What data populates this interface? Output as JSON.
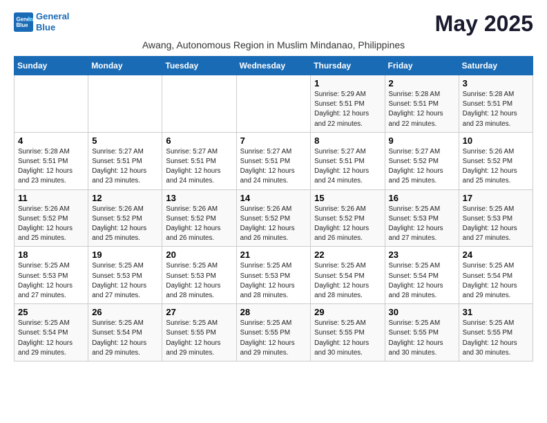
{
  "logo": {
    "line1": "General",
    "line2": "Blue"
  },
  "title": "May 2025",
  "subtitle": "Awang, Autonomous Region in Muslim Mindanao, Philippines",
  "weekdays": [
    "Sunday",
    "Monday",
    "Tuesday",
    "Wednesday",
    "Thursday",
    "Friday",
    "Saturday"
  ],
  "weeks": [
    [
      {
        "day": "",
        "sunrise": "",
        "sunset": "",
        "daylight": ""
      },
      {
        "day": "",
        "sunrise": "",
        "sunset": "",
        "daylight": ""
      },
      {
        "day": "",
        "sunrise": "",
        "sunset": "",
        "daylight": ""
      },
      {
        "day": "",
        "sunrise": "",
        "sunset": "",
        "daylight": ""
      },
      {
        "day": "1",
        "sunrise": "Sunrise: 5:29 AM",
        "sunset": "Sunset: 5:51 PM",
        "daylight": "Daylight: 12 hours and 22 minutes."
      },
      {
        "day": "2",
        "sunrise": "Sunrise: 5:28 AM",
        "sunset": "Sunset: 5:51 PM",
        "daylight": "Daylight: 12 hours and 22 minutes."
      },
      {
        "day": "3",
        "sunrise": "Sunrise: 5:28 AM",
        "sunset": "Sunset: 5:51 PM",
        "daylight": "Daylight: 12 hours and 23 minutes."
      }
    ],
    [
      {
        "day": "4",
        "sunrise": "Sunrise: 5:28 AM",
        "sunset": "Sunset: 5:51 PM",
        "daylight": "Daylight: 12 hours and 23 minutes."
      },
      {
        "day": "5",
        "sunrise": "Sunrise: 5:27 AM",
        "sunset": "Sunset: 5:51 PM",
        "daylight": "Daylight: 12 hours and 23 minutes."
      },
      {
        "day": "6",
        "sunrise": "Sunrise: 5:27 AM",
        "sunset": "Sunset: 5:51 PM",
        "daylight": "Daylight: 12 hours and 24 minutes."
      },
      {
        "day": "7",
        "sunrise": "Sunrise: 5:27 AM",
        "sunset": "Sunset: 5:51 PM",
        "daylight": "Daylight: 12 hours and 24 minutes."
      },
      {
        "day": "8",
        "sunrise": "Sunrise: 5:27 AM",
        "sunset": "Sunset: 5:51 PM",
        "daylight": "Daylight: 12 hours and 24 minutes."
      },
      {
        "day": "9",
        "sunrise": "Sunrise: 5:27 AM",
        "sunset": "Sunset: 5:52 PM",
        "daylight": "Daylight: 12 hours and 25 minutes."
      },
      {
        "day": "10",
        "sunrise": "Sunrise: 5:26 AM",
        "sunset": "Sunset: 5:52 PM",
        "daylight": "Daylight: 12 hours and 25 minutes."
      }
    ],
    [
      {
        "day": "11",
        "sunrise": "Sunrise: 5:26 AM",
        "sunset": "Sunset: 5:52 PM",
        "daylight": "Daylight: 12 hours and 25 minutes."
      },
      {
        "day": "12",
        "sunrise": "Sunrise: 5:26 AM",
        "sunset": "Sunset: 5:52 PM",
        "daylight": "Daylight: 12 hours and 25 minutes."
      },
      {
        "day": "13",
        "sunrise": "Sunrise: 5:26 AM",
        "sunset": "Sunset: 5:52 PM",
        "daylight": "Daylight: 12 hours and 26 minutes."
      },
      {
        "day": "14",
        "sunrise": "Sunrise: 5:26 AM",
        "sunset": "Sunset: 5:52 PM",
        "daylight": "Daylight: 12 hours and 26 minutes."
      },
      {
        "day": "15",
        "sunrise": "Sunrise: 5:26 AM",
        "sunset": "Sunset: 5:52 PM",
        "daylight": "Daylight: 12 hours and 26 minutes."
      },
      {
        "day": "16",
        "sunrise": "Sunrise: 5:25 AM",
        "sunset": "Sunset: 5:53 PM",
        "daylight": "Daylight: 12 hours and 27 minutes."
      },
      {
        "day": "17",
        "sunrise": "Sunrise: 5:25 AM",
        "sunset": "Sunset: 5:53 PM",
        "daylight": "Daylight: 12 hours and 27 minutes."
      }
    ],
    [
      {
        "day": "18",
        "sunrise": "Sunrise: 5:25 AM",
        "sunset": "Sunset: 5:53 PM",
        "daylight": "Daylight: 12 hours and 27 minutes."
      },
      {
        "day": "19",
        "sunrise": "Sunrise: 5:25 AM",
        "sunset": "Sunset: 5:53 PM",
        "daylight": "Daylight: 12 hours and 27 minutes."
      },
      {
        "day": "20",
        "sunrise": "Sunrise: 5:25 AM",
        "sunset": "Sunset: 5:53 PM",
        "daylight": "Daylight: 12 hours and 28 minutes."
      },
      {
        "day": "21",
        "sunrise": "Sunrise: 5:25 AM",
        "sunset": "Sunset: 5:53 PM",
        "daylight": "Daylight: 12 hours and 28 minutes."
      },
      {
        "day": "22",
        "sunrise": "Sunrise: 5:25 AM",
        "sunset": "Sunset: 5:54 PM",
        "daylight": "Daylight: 12 hours and 28 minutes."
      },
      {
        "day": "23",
        "sunrise": "Sunrise: 5:25 AM",
        "sunset": "Sunset: 5:54 PM",
        "daylight": "Daylight: 12 hours and 28 minutes."
      },
      {
        "day": "24",
        "sunrise": "Sunrise: 5:25 AM",
        "sunset": "Sunset: 5:54 PM",
        "daylight": "Daylight: 12 hours and 29 minutes."
      }
    ],
    [
      {
        "day": "25",
        "sunrise": "Sunrise: 5:25 AM",
        "sunset": "Sunset: 5:54 PM",
        "daylight": "Daylight: 12 hours and 29 minutes."
      },
      {
        "day": "26",
        "sunrise": "Sunrise: 5:25 AM",
        "sunset": "Sunset: 5:54 PM",
        "daylight": "Daylight: 12 hours and 29 minutes."
      },
      {
        "day": "27",
        "sunrise": "Sunrise: 5:25 AM",
        "sunset": "Sunset: 5:55 PM",
        "daylight": "Daylight: 12 hours and 29 minutes."
      },
      {
        "day": "28",
        "sunrise": "Sunrise: 5:25 AM",
        "sunset": "Sunset: 5:55 PM",
        "daylight": "Daylight: 12 hours and 29 minutes."
      },
      {
        "day": "29",
        "sunrise": "Sunrise: 5:25 AM",
        "sunset": "Sunset: 5:55 PM",
        "daylight": "Daylight: 12 hours and 30 minutes."
      },
      {
        "day": "30",
        "sunrise": "Sunrise: 5:25 AM",
        "sunset": "Sunset: 5:55 PM",
        "daylight": "Daylight: 12 hours and 30 minutes."
      },
      {
        "day": "31",
        "sunrise": "Sunrise: 5:25 AM",
        "sunset": "Sunset: 5:55 PM",
        "daylight": "Daylight: 12 hours and 30 minutes."
      }
    ]
  ]
}
